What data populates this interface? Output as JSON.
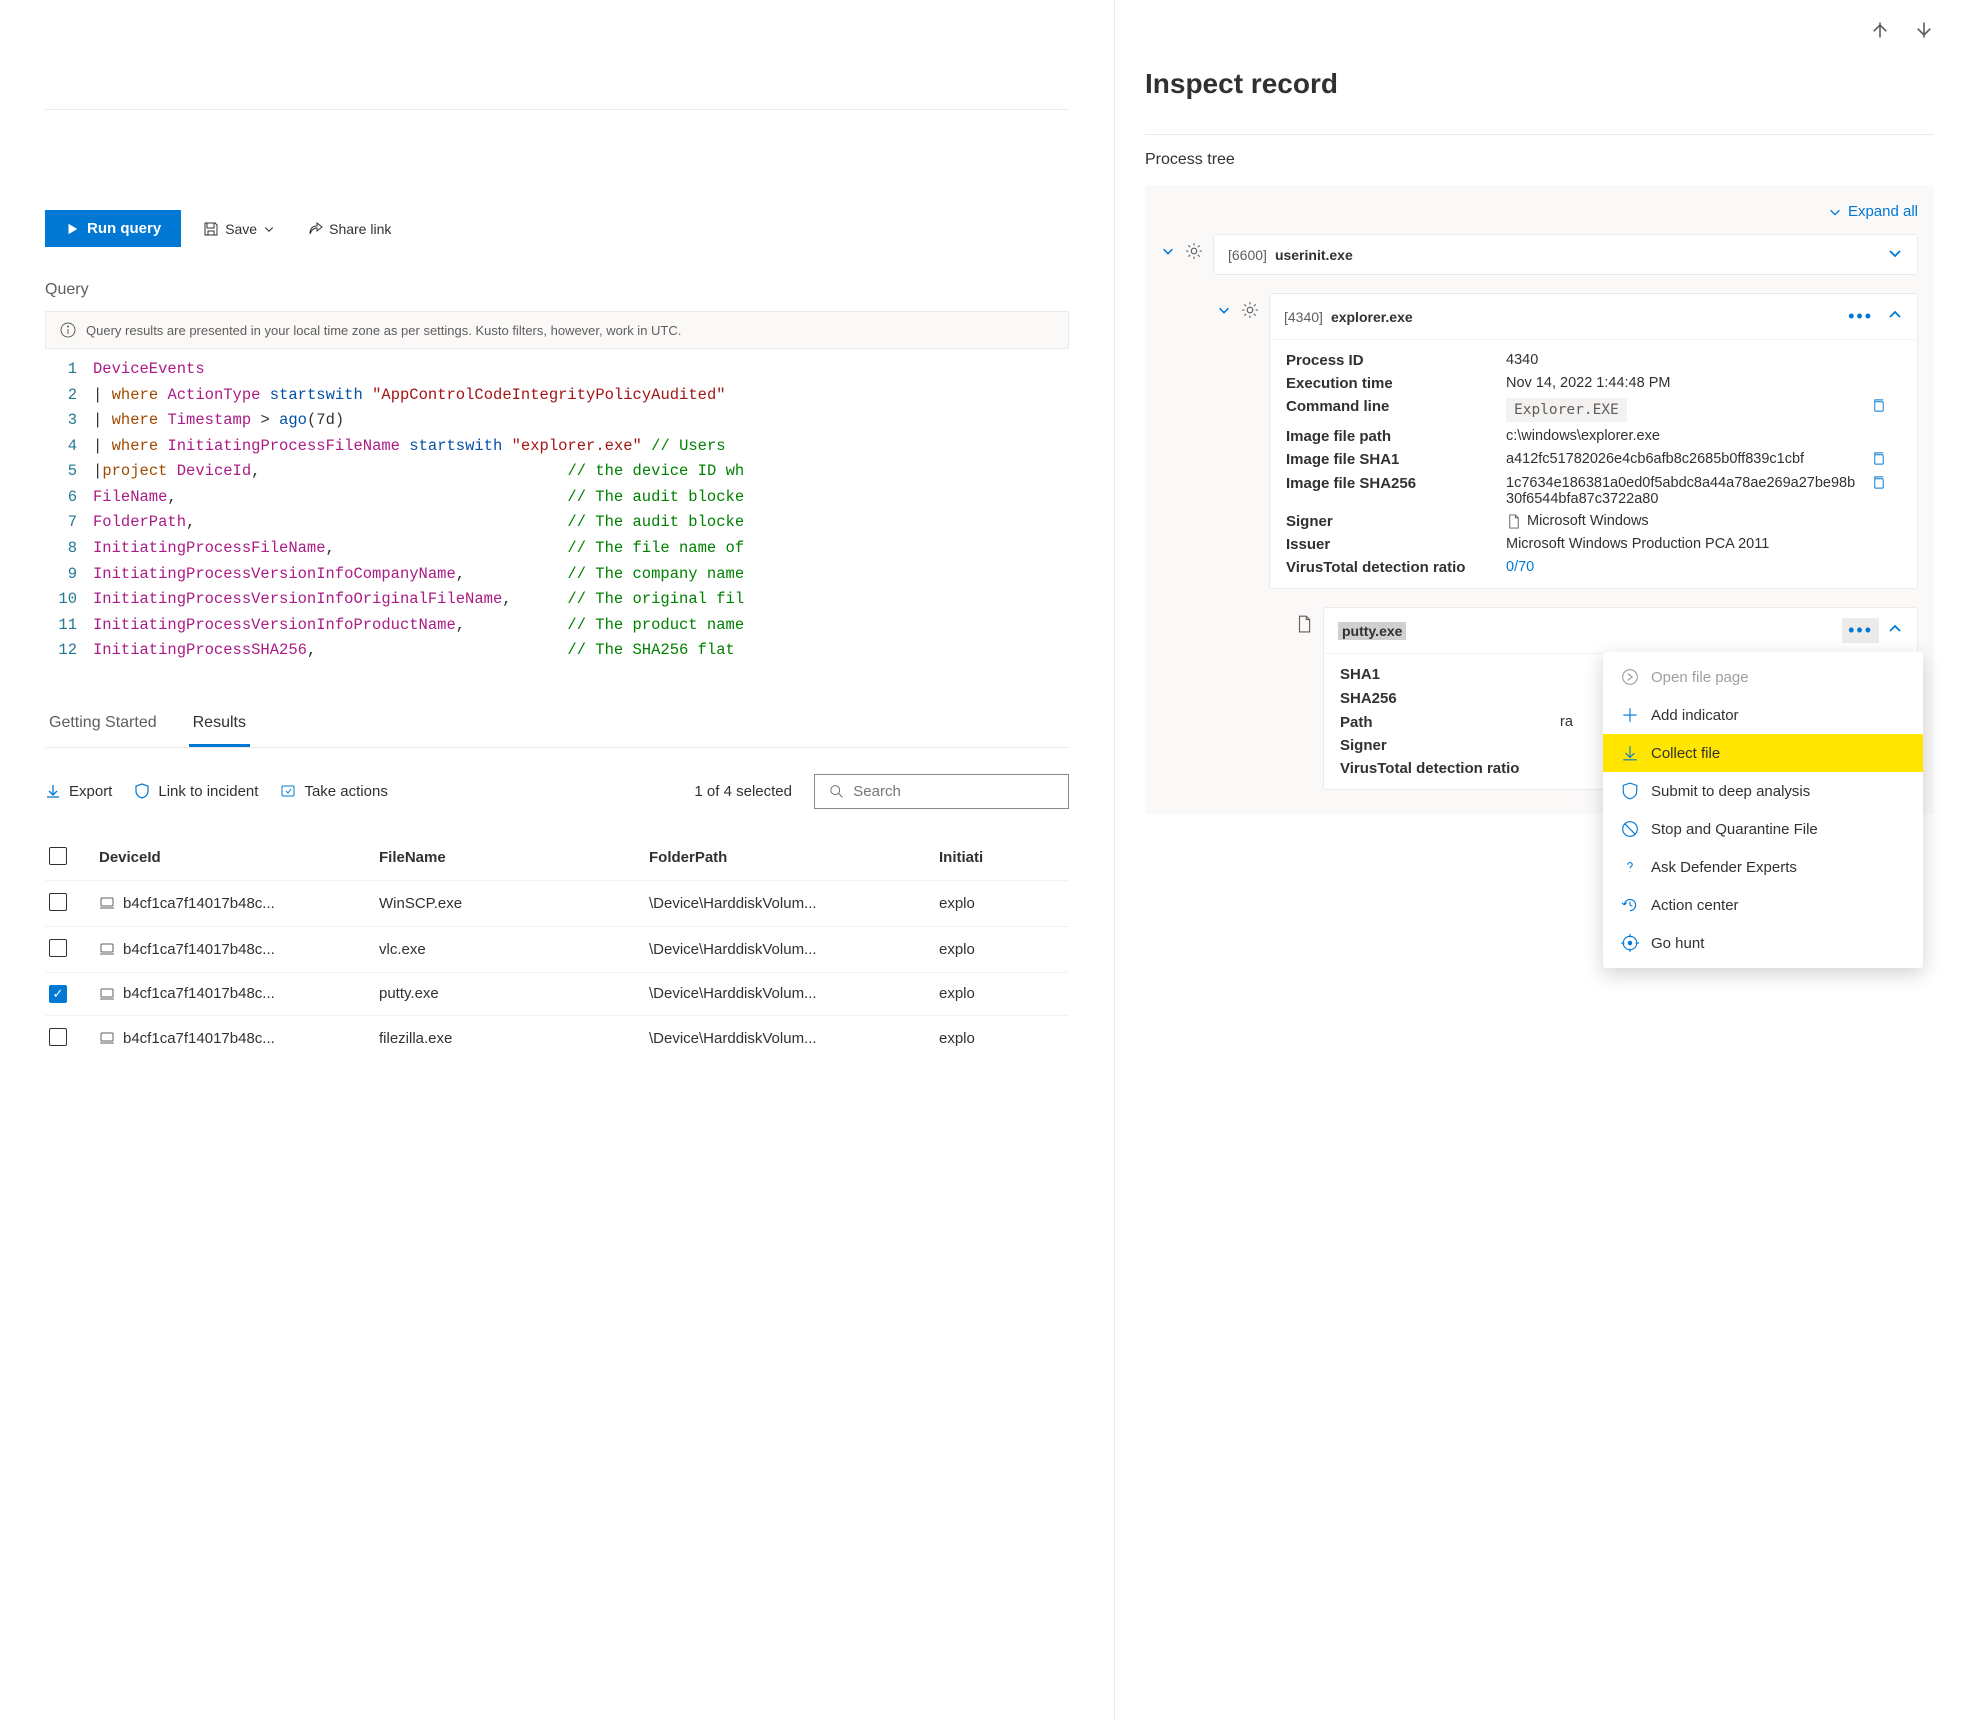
{
  "toolbar": {
    "run_label": "Run query",
    "save_label": "Save",
    "share_label": "Share link"
  },
  "query_section_label": "Query",
  "info_text": "Query results are presented in your local time zone as per settings. Kusto filters, however, work in UTC.",
  "code": [
    {
      "n": 1,
      "html": "<span class='tok-ident'>DeviceEvents</span>"
    },
    {
      "n": 2,
      "html": "<span class='tok-op'>| </span><span class='tok-kw'>where</span> <span class='tok-ident'>ActionType</span> <span class='tok-func'>startswith</span> <span class='tok-str'>\"AppControlCodeIntegrityPolicyAudited\"</span>"
    },
    {
      "n": 3,
      "html": "<span class='tok-op'>| </span><span class='tok-kw'>where</span> <span class='tok-ident'>Timestamp</span> &gt; <span class='tok-func'>ago</span>(7d)"
    },
    {
      "n": 4,
      "html": "<span class='tok-op'>| </span><span class='tok-kw'>where</span> <span class='tok-ident'>InitiatingProcessFileName</span> <span class='tok-func'>startswith</span> <span class='tok-str'>\"explorer.exe\"</span> <span class='tok-cmt'>// Users</span>"
    },
    {
      "n": 5,
      "html": "<span class='tok-op'>|</span><span class='tok-kw'>project</span> <span class='tok-ident'>DeviceId</span>,                                 <span class='tok-cmt'>// the device ID wh</span>"
    },
    {
      "n": 6,
      "html": "<span class='tok-ident'>FileName</span>,                                          <span class='tok-cmt'>// The audit blocke</span>"
    },
    {
      "n": 7,
      "html": "<span class='tok-ident'>FolderPath</span>,                                        <span class='tok-cmt'>// The audit blocke</span>"
    },
    {
      "n": 8,
      "html": "<span class='tok-ident'>InitiatingProcessFileName</span>,                         <span class='tok-cmt'>// The file name of</span>"
    },
    {
      "n": 9,
      "html": "<span class='tok-ident'>InitiatingProcessVersionInfoCompanyName</span>,           <span class='tok-cmt'>// The company name</span>"
    },
    {
      "n": 10,
      "html": "<span class='tok-ident'>InitiatingProcessVersionInfoOriginalFileName</span>,      <span class='tok-cmt'>// The original fil</span>"
    },
    {
      "n": 11,
      "html": "<span class='tok-ident'>InitiatingProcessVersionInfoProductName</span>,           <span class='tok-cmt'>// The product name</span>"
    },
    {
      "n": 12,
      "html": "<span class='tok-ident'>InitiatingProcessSHA256</span>,                           <span class='tok-cmt'>// The SHA256 flat </span>"
    }
  ],
  "tabs": {
    "getting_started": "Getting Started",
    "results": "Results"
  },
  "actions": {
    "export": "Export",
    "link": "Link to incident",
    "take": "Take actions"
  },
  "selection_summary": "1 of 4 selected",
  "search_placeholder": "Search",
  "columns": {
    "device": "DeviceId",
    "file": "FileName",
    "folder": "FolderPath",
    "init": "Initiati"
  },
  "rows": [
    {
      "checked": false,
      "device": "b4cf1ca7f14017b48c...",
      "file": "WinSCP.exe",
      "folder": "\\Device\\HarddiskVolum...",
      "init": "explo"
    },
    {
      "checked": false,
      "device": "b4cf1ca7f14017b48c...",
      "file": "vlc.exe",
      "folder": "\\Device\\HarddiskVolum...",
      "init": "explo"
    },
    {
      "checked": true,
      "device": "b4cf1ca7f14017b48c...",
      "file": "putty.exe",
      "folder": "\\Device\\HarddiskVolum...",
      "init": "explo"
    },
    {
      "checked": false,
      "device": "b4cf1ca7f14017b48c...",
      "file": "filezilla.exe",
      "folder": "\\Device\\HarddiskVolum...",
      "init": "explo"
    }
  ],
  "panel": {
    "title": "Inspect record",
    "section": "Process tree",
    "expand_all": "Expand all"
  },
  "tree": {
    "n1": {
      "pid": "[6600]",
      "name": "userinit.exe"
    },
    "n2": {
      "pid": "[4340]",
      "name": "explorer.exe",
      "kv": {
        "process_id_k": "Process ID",
        "process_id_v": "4340",
        "exec_k": "Execution time",
        "exec_v": "Nov 14, 2022 1:44:48 PM",
        "cmd_k": "Command line",
        "cmd_v": "Explorer.EXE",
        "path_k": "Image file path",
        "path_v": "c:\\windows\\explorer.exe",
        "sha1_k": "Image file SHA1",
        "sha1_v": "a412fc51782026e4cb6afb8c2685b0ff839c1cbf",
        "sha256_k": "Image file SHA256",
        "sha256_v": "1c7634e186381a0ed0f5abdc8a44a78ae269a27be98b30f6544bfa87c3722a80",
        "signer_k": "Signer",
        "signer_v": "Microsoft Windows",
        "issuer_k": "Issuer",
        "issuer_v": "Microsoft Windows Production PCA 2011",
        "vt_k": "VirusTotal detection ratio",
        "vt_v": "0/70"
      }
    },
    "n3": {
      "name": "putty.exe",
      "kv": {
        "sha1_k": "SHA1",
        "sha256_k": "SHA256",
        "path_k": "Path",
        "signer_k": "Signer",
        "vt_k": "VirusTotal detection ratio"
      }
    }
  },
  "ctx": {
    "open": "Open file page",
    "add": "Add indicator",
    "collect": "Collect file",
    "deep": "Submit to deep analysis",
    "stop": "Stop and Quarantine File",
    "ask": "Ask Defender Experts",
    "action": "Action center",
    "hunt": "Go hunt"
  }
}
